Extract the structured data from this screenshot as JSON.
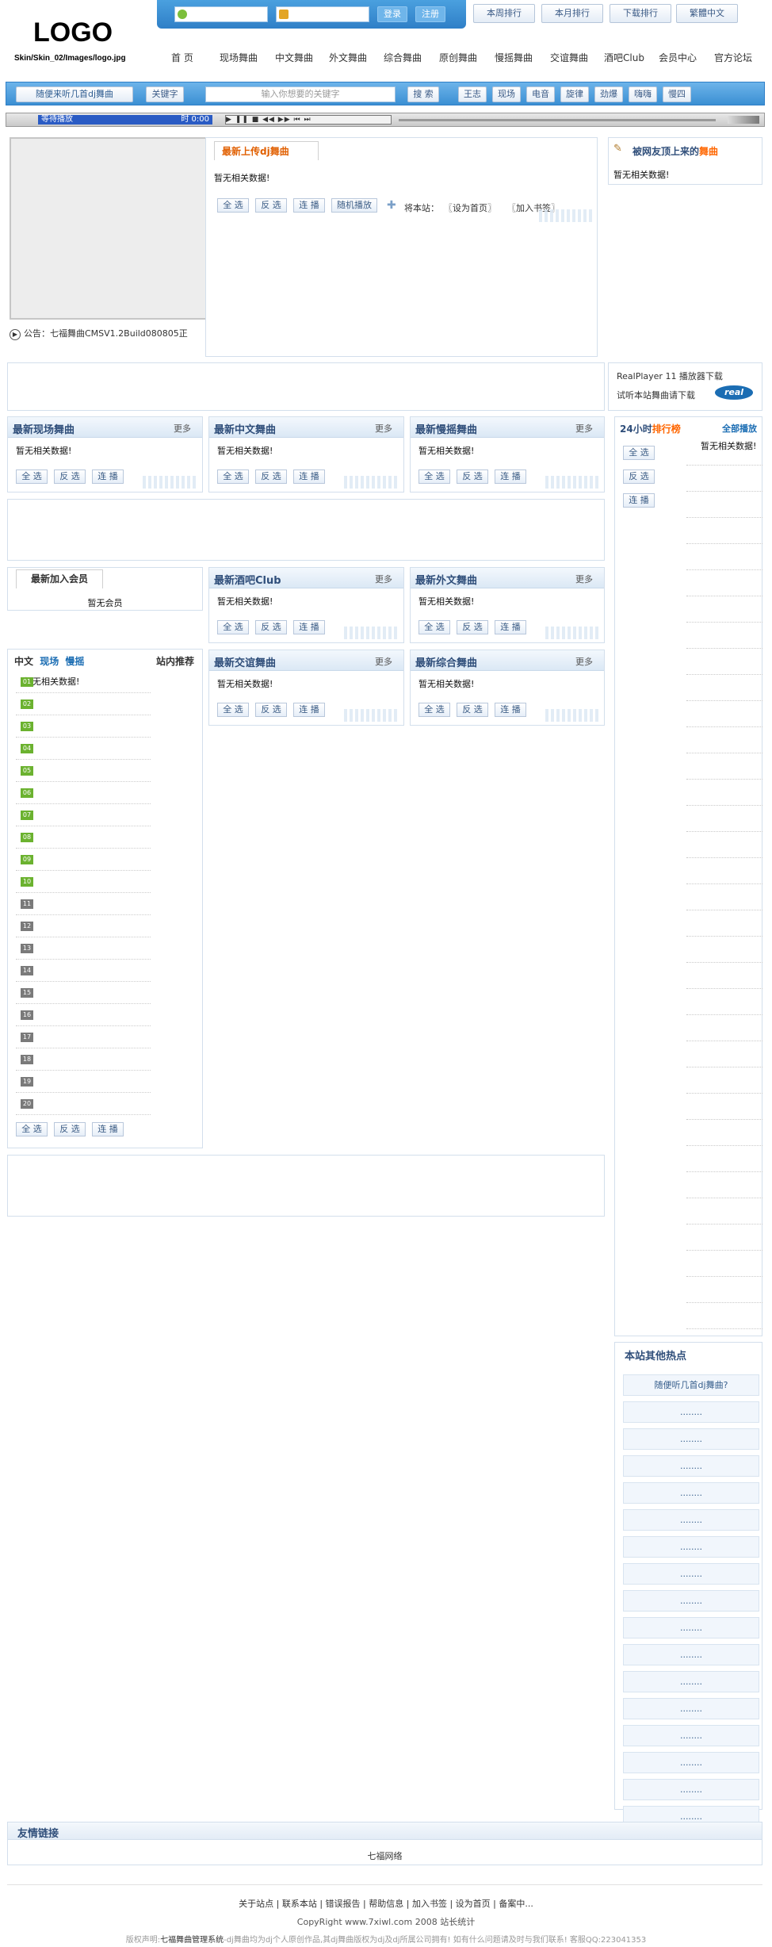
{
  "logo": {
    "text": "LOGO",
    "path": "Skin/Skin_02/Images/logo.jpg"
  },
  "login": {
    "login_btn": "登录",
    "register_btn": "注册"
  },
  "top_links": [
    "本周排行",
    "本月排行",
    "下载排行",
    "繁體中文"
  ],
  "nav": [
    "首 页",
    "现场舞曲",
    "中文舞曲",
    "外文舞曲",
    "综合舞曲",
    "原创舞曲",
    "慢摇舞曲",
    "交谊舞曲",
    "酒吧Club",
    "会员中心",
    "官方论坛"
  ],
  "search": {
    "random_label": "随便来听几首dj舞曲",
    "keyword_label": "关键字",
    "placeholder": "输入你想要的关键字",
    "search_btn": "搜 索",
    "tags": [
      "王志",
      "现场",
      "电音",
      "旋律",
      "劲爆",
      "嗨嗨",
      "慢四"
    ]
  },
  "player": {
    "status": "等待播放",
    "time": "时 0:00"
  },
  "notice": "公告：七福舞曲CMSV1.2Build080805正",
  "latest_upload": {
    "title": "最新上传dj舞曲",
    "nodata": "暂无相关数据!",
    "buttons": [
      "全 选",
      "反 选",
      "连 播",
      "随机播放"
    ],
    "site_label": "将本站：",
    "set_home": "〖设为首页〗",
    "add_bookmark": "〖加入书签〗"
  },
  "user_top": {
    "title_prefix": "被网友顶上来的",
    "title_accent": "舞曲",
    "nodata": "暂无相关数据!"
  },
  "realplayer": {
    "line1": "RealPlayer 11 播放器下载",
    "line2": "试听本站舞曲请下载",
    "badge": "real"
  },
  "cat_boxes": [
    {
      "title": "最新现场舞曲",
      "more": "更多",
      "nodata": "暂无相关数据!"
    },
    {
      "title": "最新中文舞曲",
      "more": "更多",
      "nodata": "暂无相关数据!"
    },
    {
      "title": "最新慢摇舞曲",
      "more": "更多",
      "nodata": "暂无相关数据!"
    },
    {
      "title": "最新酒吧Club",
      "more": "更多",
      "nodata": "暂无相关数据!"
    },
    {
      "title": "最新外文舞曲",
      "more": "更多",
      "nodata": "暂无相关数据!"
    },
    {
      "title": "最新交谊舞曲",
      "more": "更多",
      "nodata": "暂无相关数据!"
    },
    {
      "title": "最新综合舞曲",
      "more": "更多",
      "nodata": "暂无相关数据!"
    }
  ],
  "box_buttons": [
    "全 选",
    "反 选",
    "连 播"
  ],
  "rank24": {
    "title_prefix": "24小时",
    "title_accent": "排行榜",
    "play_all": "全部播放",
    "nodata": "暂无相关数据!",
    "buttons": [
      "全 选",
      "反 选",
      "连 播"
    ]
  },
  "new_members": {
    "title": "最新加入会员",
    "nodata": "暂无会员"
  },
  "recommend": {
    "tabs": [
      "中文",
      "现场",
      "慢摇"
    ],
    "title": "站内推荐",
    "nodata": "暂无相关数据!",
    "numbers": [
      "01",
      "02",
      "03",
      "04",
      "05",
      "06",
      "07",
      "08",
      "09",
      "10",
      "11",
      "12",
      "13",
      "14",
      "15",
      "16",
      "17",
      "18",
      "19",
      "20"
    ]
  },
  "hot": {
    "title": "本站其他热点",
    "first": "随便听几首dj舞曲?",
    "dots": "........"
  },
  "friend_links": {
    "title": "友情链接",
    "item": "七福网络"
  },
  "footer": {
    "links": [
      "关于站点",
      "联系本站",
      "错误报告",
      "帮助信息",
      "加入书签",
      "设为首页",
      "备案中..."
    ],
    "copyright": "CopyRight www.7xiwl.com 2008 站长统计",
    "disclaimer_prefix": "版权声明:",
    "disclaimer_name": "七福舞曲管理系统",
    "disclaimer_rest": "-dj舞曲均为dj个人原创作品,其dj舞曲版权为dj及dj所属公司拥有! 如有什么问题请及时与我们联系! 客服QQ:223041353"
  },
  "colors": {
    "accent": "#ff6600",
    "primary": "#2f4e7a",
    "bar": "#3c8ed6"
  }
}
